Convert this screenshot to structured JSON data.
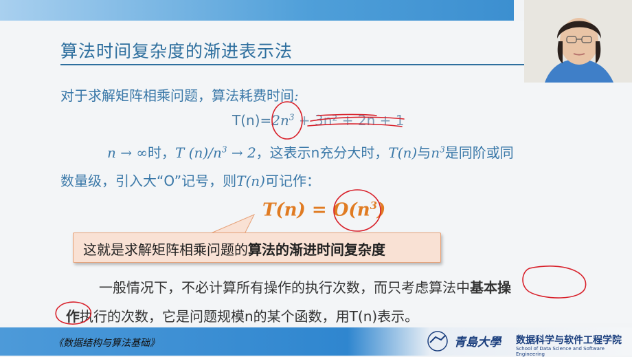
{
  "slide": {
    "title": "算法时间复杂度的渐进表示法",
    "intro": "对于求解矩阵相乘问题，算法耗费时间",
    "intro_colon": ":",
    "equation": {
      "lhs": "T(n)=",
      "term1": "2n",
      "term1_exp": "3",
      "rest": " + 3n² + 2n + 1"
    },
    "line1": {
      "a": "n → ∞",
      "b": "时，",
      "c": "T (n)/n",
      "c_exp": "3",
      "d": " → 2",
      "e": "，这表示n充分大时，",
      "f": "T(n)",
      "g": "与",
      "h": "n",
      "h_exp": "3",
      "i": "是同阶或同"
    },
    "line2": {
      "a": "数量级，引入大“O”记号，则",
      "b": "T(n)",
      "c": "可记作："
    },
    "big_formula": {
      "lhs": "T(n) = ",
      "rhs_o": "O(n",
      "rhs_exp": "3",
      "rhs_close": ")"
    },
    "callout": {
      "prefix": "这就是求解矩阵相乘问题的",
      "bold": "算法的渐进时间复杂度"
    },
    "para": {
      "line1_plain": "一般情况下，不必计算所有操作的执行次数，而只考虑算法中",
      "line1_bold": "基本操",
      "line2_bold": "作",
      "line2_plain": "执行的次数，它是问题规模n的某个函数，用T(n)表示。"
    }
  },
  "footer": {
    "book": "《数据结构与算法基础》",
    "university": "青島大學",
    "school_cn": "数据科学与软件工程学院",
    "school_en": "School of Data Science and Software Engineering"
  },
  "colors": {
    "accent_blue": "#3a78a8",
    "formula_orange": "#e07b22",
    "ink_red": "#d8202a"
  }
}
